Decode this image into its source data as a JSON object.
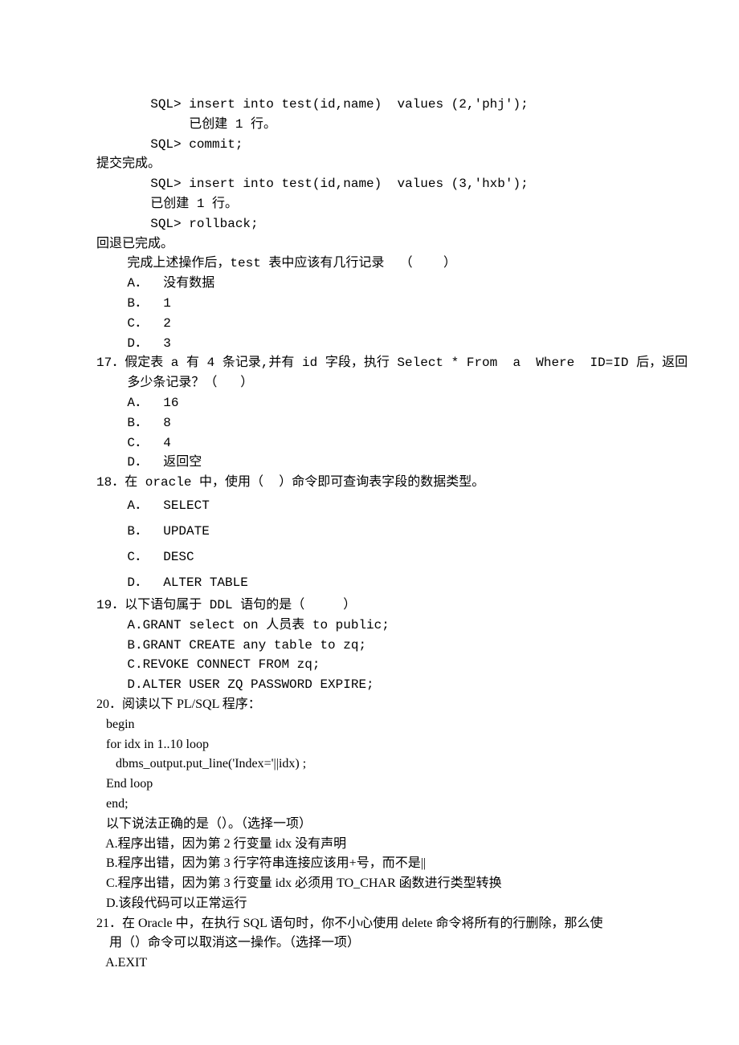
{
  "intro": {
    "l1": "       SQL> insert into test(id,name)  values (2,'phj');",
    "l2": "            已创建 1 行。",
    "l3": "       SQL> commit;",
    "l4": "提交完成。",
    "l5": "       SQL> insert into test(id,name)  values (3,'hxb');",
    "l6": "       已创建 1 行。",
    "l7": "       SQL> rollback;",
    "l8": "回退已完成。"
  },
  "q16": {
    "prompt": "    完成上述操作后，test 表中应该有几行记录  （    ）",
    "a": "    A．  没有数据",
    "b": "    B．  1",
    "c": "    C．  2",
    "d": "    D．  3"
  },
  "q17": {
    "line1": "17．假定表 a 有 4 条记录,并有 id 字段，执行 Select * From  a  Where  ID=ID 后，返回",
    "line2": "    多少条记录？（   ）",
    "a": "    A．  16",
    "b": "    B．  8",
    "c": "    C．  4",
    "d": "    D．  返回空"
  },
  "q18": {
    "prompt": "18．在 oracle 中，使用（  ）命令即可查询表字段的数据类型。",
    "a": "    A．  SELECT",
    "b": "    B．  UPDATE",
    "c": "    C．  DESC",
    "d": "    D．  ALTER TABLE"
  },
  "q19": {
    "prompt": "19．以下语句属于 DDL 语句的是（     ）",
    "a": "    A.GRANT select on 人员表 to public;",
    "b": "    B.GRANT CREATE any table to zq;",
    "c": "    C.REVOKE CONNECT FROM zq;",
    "d": "    D.ALTER USER ZQ PASSWORD EXPIRE;"
  },
  "q20": {
    "prompt": "20．阅读以下 PL/SQL 程序：",
    "code1": "   begin",
    "code2": "   for idx in 1..10 loop",
    "code3": "      dbms_output.put_line('Index='||idx) ;",
    "code4": "   End loop",
    "code5": "   end;",
    "sub": "   以下说法正确的是（）。（选择一项）",
    "a": "   A.程序出错，因为第 2 行变量 idx 没有声明",
    "b": "   B.程序出错，因为第 3 行字符串连接应该用+号，而不是||",
    "c": "   C.程序出错，因为第 3 行变量 idx 必须用 TO_CHAR 函数进行类型转换",
    "d": "   D.该段代码可以正常运行"
  },
  "q21": {
    "line1": "21．在 Oracle 中，在执行 SQL 语句时，你不小心使用 delete 命令将所有的行删除，那么使",
    "line2": "    用（）命令可以取消这一操作。（选择一项）",
    "a": "   A.EXIT"
  }
}
